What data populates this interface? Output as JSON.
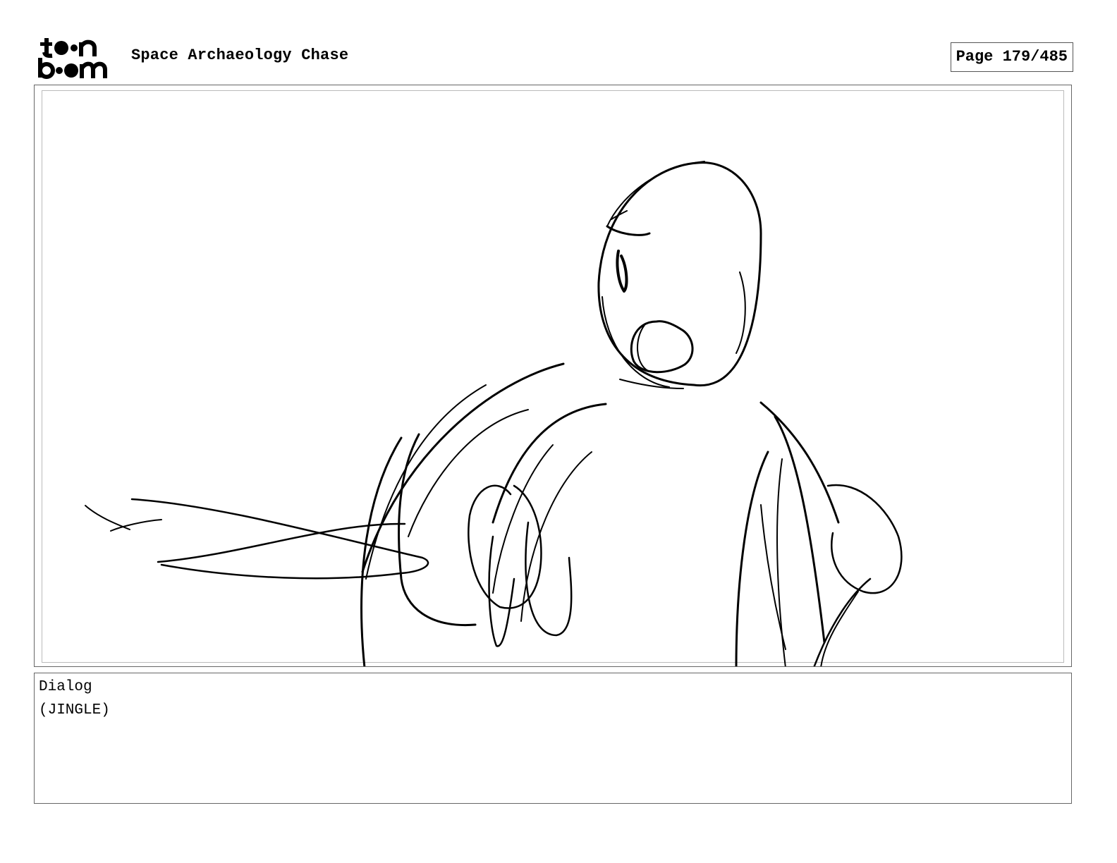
{
  "header": {
    "logo_lines": [
      "toon",
      "boom"
    ],
    "project_title": "Space Archaeology Chase",
    "page_indicator": "Page 179/485"
  },
  "panel": {
    "image_icon": "storyboard-sketch-character"
  },
  "dialog": {
    "label": "Dialog",
    "text": "(JINGLE)"
  }
}
